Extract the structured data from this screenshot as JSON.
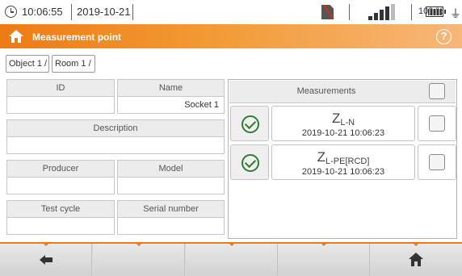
{
  "status": {
    "time": "10:06:55",
    "date": "2019-10-21",
    "battery_percent": "100 %",
    "signal_level_bars": 4
  },
  "header": {
    "title": "Measurement point",
    "help_symbol": "?"
  },
  "breadcrumb": [
    "Object 1 /",
    "Room 1 /"
  ],
  "form": {
    "id_label": "ID",
    "id_value": "",
    "name_label": "Name",
    "name_value": "Socket 1",
    "description_label": "Description",
    "description_value": "",
    "producer_label": "Producer",
    "producer_value": "",
    "model_label": "Model",
    "model_value": "",
    "test_cycle_label": "Test cycle",
    "test_cycle_value": "",
    "serial_label": "Serial number",
    "serial_value": ""
  },
  "measurements": {
    "header_label": "Measurements",
    "items": [
      {
        "symbol": "Z",
        "subscript": "L-N",
        "timestamp": "2019-10-21 10:06:23",
        "status": "ok"
      },
      {
        "symbol": "Z",
        "subscript": "L-PE[RCD]",
        "timestamp": "2019-10-21 10:06:23",
        "status": "ok"
      }
    ]
  },
  "colors": {
    "accent": "#ee7b15",
    "ok_green": "#2e7d32"
  }
}
